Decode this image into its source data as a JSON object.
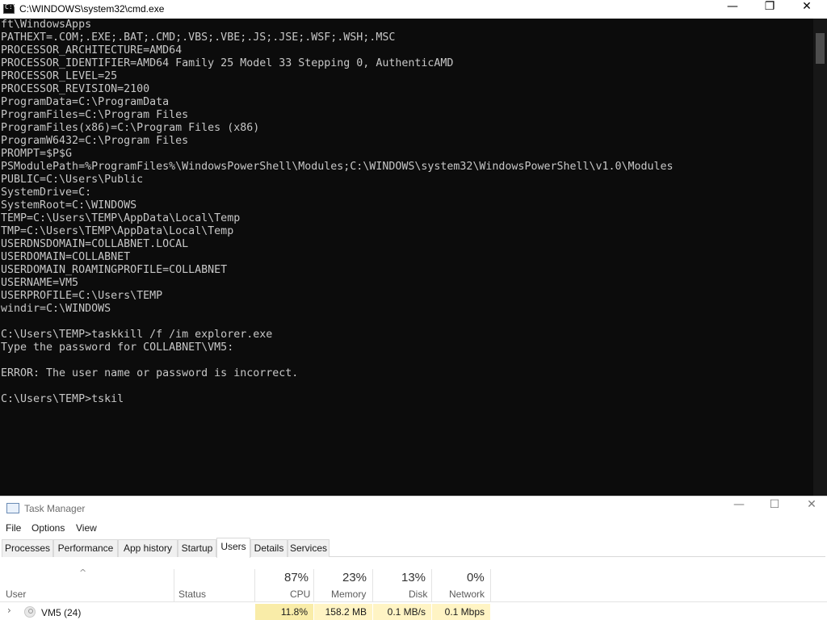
{
  "cmd": {
    "title": "C:\\WINDOWS\\system32\\cmd.exe",
    "icon": "cmd-icon",
    "controls": {
      "minimize": "—",
      "maximize": "❐",
      "close": "✕"
    },
    "lines": [
      "ft\\WindowsApps",
      "PATHEXT=.COM;.EXE;.BAT;.CMD;.VBS;.VBE;.JS;.JSE;.WSF;.WSH;.MSC",
      "PROCESSOR_ARCHITECTURE=AMD64",
      "PROCESSOR_IDENTIFIER=AMD64 Family 25 Model 33 Stepping 0, AuthenticAMD",
      "PROCESSOR_LEVEL=25",
      "PROCESSOR_REVISION=2100",
      "ProgramData=C:\\ProgramData",
      "ProgramFiles=C:\\Program Files",
      "ProgramFiles(x86)=C:\\Program Files (x86)",
      "ProgramW6432=C:\\Program Files",
      "PROMPT=$P$G",
      "PSModulePath=%ProgramFiles%\\WindowsPowerShell\\Modules;C:\\WINDOWS\\system32\\WindowsPowerShell\\v1.0\\Modules",
      "PUBLIC=C:\\Users\\Public",
      "SystemDrive=C:",
      "SystemRoot=C:\\WINDOWS",
      "TEMP=C:\\Users\\TEMP\\AppData\\Local\\Temp",
      "TMP=C:\\Users\\TEMP\\AppData\\Local\\Temp",
      "USERDNSDOMAIN=COLLABNET.LOCAL",
      "USERDOMAIN=COLLABNET",
      "USERDOMAIN_ROAMINGPROFILE=COLLABNET",
      "USERNAME=VM5",
      "USERPROFILE=C:\\Users\\TEMP",
      "windir=C:\\WINDOWS",
      "",
      "C:\\Users\\TEMP>taskkill /f /im explorer.exe",
      "Type the password for COLLABNET\\VM5:",
      "",
      "ERROR: The user name or password is incorrect.",
      "",
      "C:\\Users\\TEMP>tskil"
    ]
  },
  "taskmanager": {
    "title": "Task Manager",
    "controls": {
      "minimize": "—",
      "maximize": "☐",
      "close": "✕"
    },
    "menu": [
      "File",
      "Options",
      "View"
    ],
    "tabs": [
      "Processes",
      "Performance",
      "App history",
      "Startup",
      "Users",
      "Details",
      "Services"
    ],
    "active_tab": "Users",
    "sort_arrow": "^",
    "columns": {
      "user": "User",
      "status": "Status",
      "cpu": {
        "pct": "87%",
        "label": "CPU"
      },
      "memory": {
        "pct": "23%",
        "label": "Memory"
      },
      "disk": {
        "pct": "13%",
        "label": "Disk"
      },
      "network": {
        "pct": "0%",
        "label": "Network"
      }
    },
    "rows": [
      {
        "expand": "›",
        "user": "VM5 (24)",
        "status": "",
        "cpu": "11.8%",
        "memory": "158.2 MB",
        "disk": "0.1 MB/s",
        "network": "0.1 Mbps"
      }
    ],
    "colors": {
      "heat_light": "#fff4c4",
      "heat_medium": "#f9eca8"
    }
  }
}
